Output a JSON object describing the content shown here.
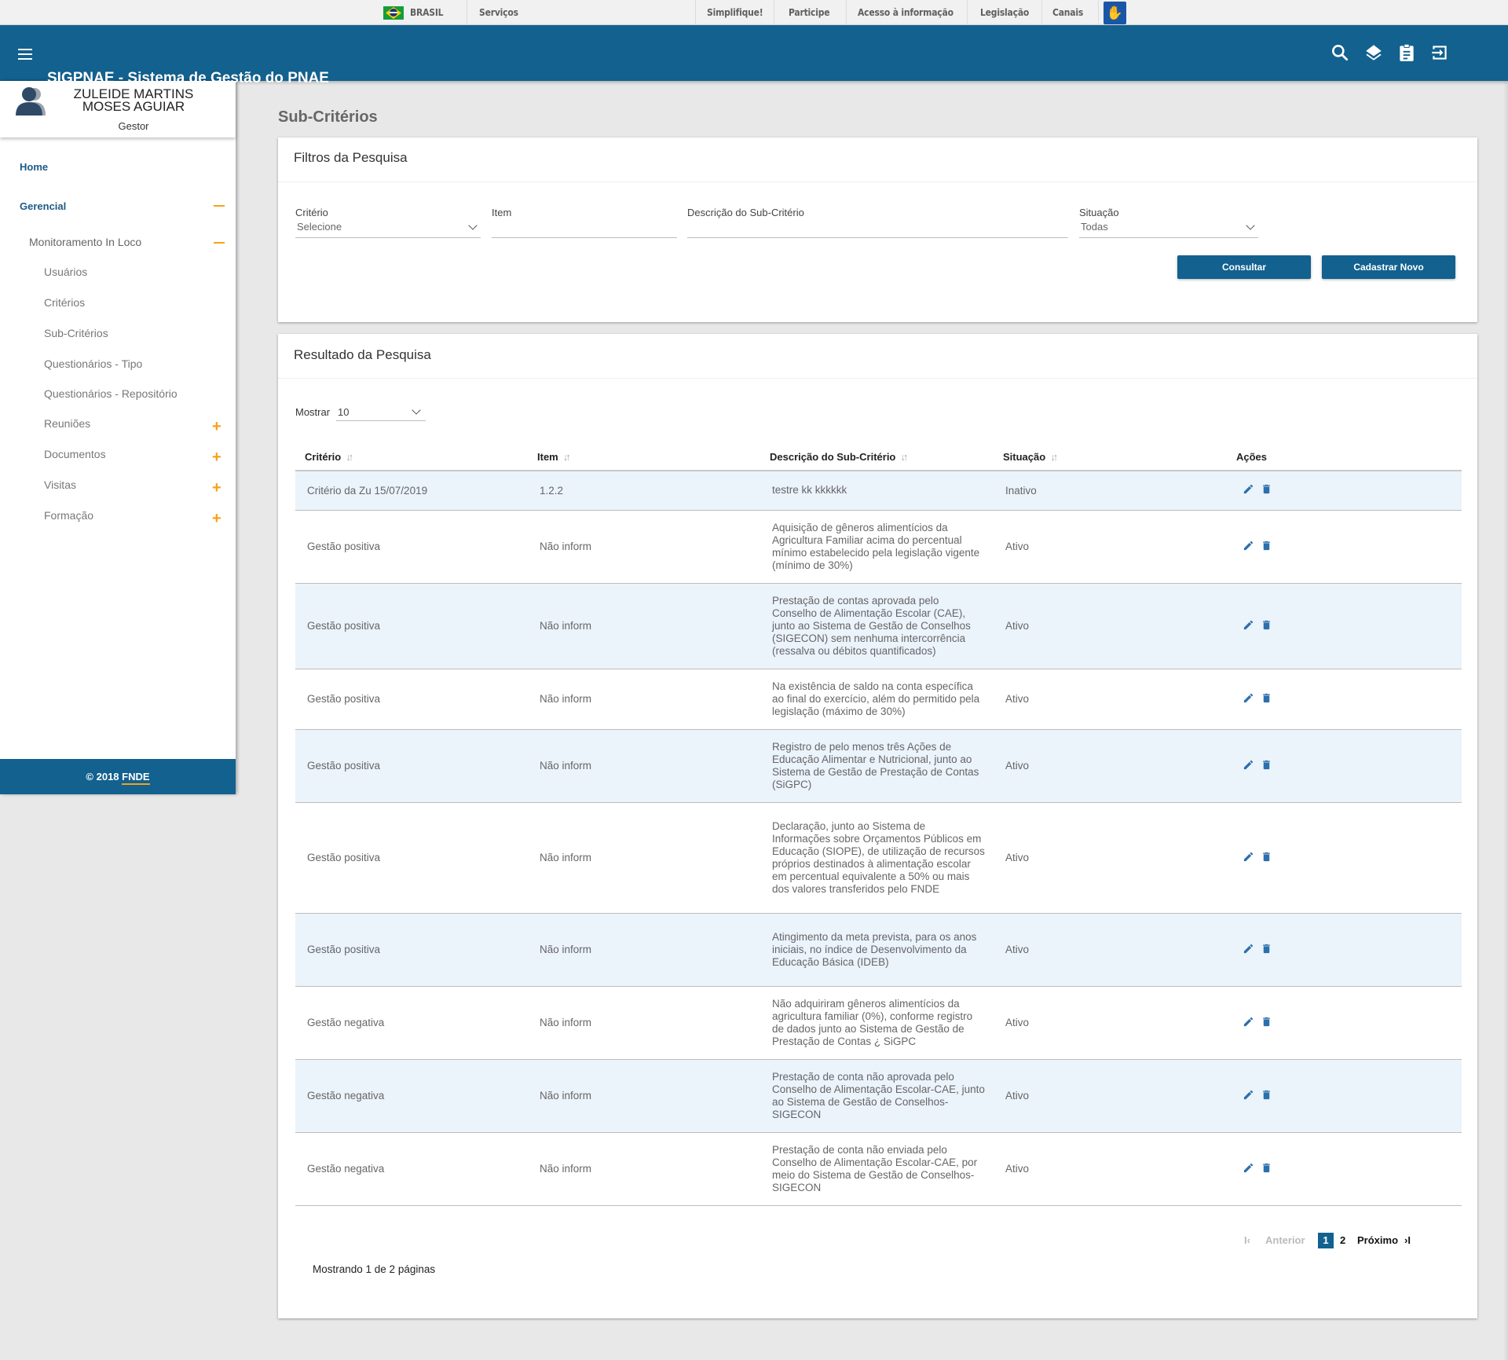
{
  "govbar": {
    "country": "BRASIL",
    "services": "Serviços",
    "links": [
      "Simplifique!",
      "Participe",
      "Acesso à informação",
      "Legislação",
      "Canais"
    ],
    "accessibility_icon": "hand-sign-language-icon"
  },
  "header": {
    "app_title": "SIGPNAE - Sistema de Gestão do PNAE",
    "icons": [
      "search-icon",
      "layers-icon",
      "clipboard-icon",
      "logout-icon"
    ]
  },
  "user": {
    "name": "ZULEIDE MARTINS MOSES AGUIAR",
    "role": "Gestor"
  },
  "sidebar": {
    "items": [
      {
        "label": "Home",
        "level": 0
      },
      {
        "label": "Gerencial",
        "level": 0,
        "toggle": "collapse"
      },
      {
        "label": "Monitoramento In Loco",
        "level": 1,
        "toggle": "collapse"
      },
      {
        "label": "Usuários",
        "level": 2
      },
      {
        "label": "Critérios",
        "level": 2
      },
      {
        "label": "Sub-Critérios",
        "level": 2
      },
      {
        "label": "Questionários - Tipo",
        "level": 2
      },
      {
        "label": "Questionários - Repositório",
        "level": 2
      },
      {
        "label": "Reuniões",
        "level": 2,
        "toggle": "expand"
      },
      {
        "label": "Documentos",
        "level": 2,
        "toggle": "expand"
      },
      {
        "label": "Visitas",
        "level": 2,
        "toggle": "expand"
      },
      {
        "label": "Formação",
        "level": 2,
        "toggle": "expand"
      }
    ],
    "footer_prefix": "© 2018",
    "footer_brand": "FNDE"
  },
  "page": {
    "title": "Sub-Critérios"
  },
  "filters": {
    "title": "Filtros da Pesquisa",
    "criterio_label": "Critério",
    "criterio_value": "Selecione",
    "item_label": "Item",
    "item_value": "",
    "descricao_label": "Descrição do Sub-Critério",
    "descricao_value": "",
    "situacao_label": "Situação",
    "situacao_value": "Todas",
    "consultar_label": "Consultar",
    "cadastrar_label": "Cadastrar Novo"
  },
  "results": {
    "title": "Resultado da Pesquisa",
    "show_label": "Mostrar",
    "show_value": "10",
    "columns": [
      "Critério",
      "Item",
      "Descrição do Sub-Critério",
      "Situação",
      "Ações"
    ],
    "rows": [
      {
        "criterio": "Critério da Zu 15/07/2019",
        "item": "1.2.2",
        "descricao": "testre kk kkkkkk",
        "situacao": "Inativo"
      },
      {
        "criterio": "Gestão positiva",
        "item": "Não inform",
        "descricao": "Aquisição de gêneros alimentícios da Agricultura Familiar acima do percentual mínimo estabelecido pela legislação vigente (mínimo de 30%)",
        "situacao": "Ativo"
      },
      {
        "criterio": "Gestão positiva",
        "item": "Não inform",
        "descricao": "Prestação de contas aprovada pelo Conselho de Alimentação Escolar (CAE), junto ao Sistema de Gestão de Conselhos (SIGECON) sem nenhuma intercorrência (ressalva ou débitos quantificados)",
        "situacao": "Ativo"
      },
      {
        "criterio": "Gestão positiva",
        "item": "Não inform",
        "descricao": "Na existência de saldo na conta específica ao final do exercício, além do permitido pela legislação (máximo de 30%)",
        "situacao": "Ativo"
      },
      {
        "criterio": "Gestão positiva",
        "item": "Não inform",
        "descricao": "Registro de pelo menos três Ações de Educação Alimentar e Nutricional, junto ao Sistema de Gestão de Prestação de Contas (SiGPC)",
        "situacao": "Ativo"
      },
      {
        "criterio": "Gestão positiva",
        "item": "Não inform",
        "descricao": "Declaração, junto ao Sistema de Informações sobre Orçamentos Públicos em Educação (SIOPE), de utilização de recursos próprios destinados à alimentação escolar em percentual equivalente a 50% ou mais dos valores transferidos pelo FNDE",
        "situacao": "Ativo"
      },
      {
        "criterio": "Gestão positiva",
        "item": "Não inform",
        "descricao": "Atingimento da meta prevista, para os anos iniciais, no índice de Desenvolvimento da Educação Básica (IDEB)",
        "situacao": "Ativo"
      },
      {
        "criterio": "Gestão negativa",
        "item": "Não inform",
        "descricao": "Não adquiriram gêneros alimentícios da agricultura familiar (0%), conforme registro de dados junto ao Sistema de Gestão de Prestação de Contas ¿ SiGPC",
        "situacao": "Ativo"
      },
      {
        "criterio": "Gestão negativa",
        "item": "Não inform",
        "descricao": "Prestação de conta não aprovada pelo Conselho de Alimentação Escolar-CAE, junto ao Sistema de Gestão de Conselhos-SIGECON",
        "situacao": "Ativo"
      },
      {
        "criterio": "Gestão negativa",
        "item": "Não inform",
        "descricao": "Prestação de conta não enviada pelo Conselho de Alimentação Escolar-CAE, por meio do Sistema de Gestão de Conselhos-SIGECON",
        "situacao": "Ativo"
      }
    ],
    "showing_text": "Mostrando 1 de 2 páginas",
    "pagination": {
      "first_icon": "first-page-icon",
      "previous_label": "Anterior",
      "pages": [
        "1",
        "2"
      ],
      "current_page": "1",
      "next_label": "Próximo",
      "last_icon": "last-page-icon"
    }
  },
  "colors": {
    "primary": "#12618f",
    "accent": "#f7a11a",
    "row_alt": "#ebf3fb",
    "action_icon": "#2c6fad"
  }
}
